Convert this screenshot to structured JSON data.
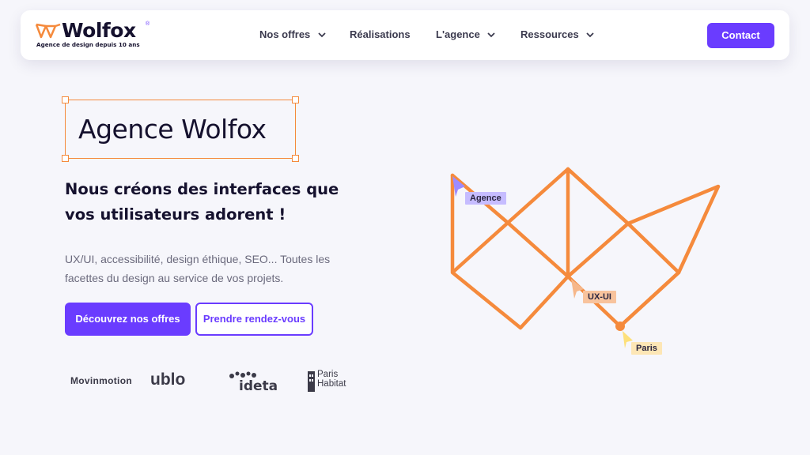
{
  "brand": {
    "name": "Wolfox",
    "registered": "®",
    "tagline": "Agence de design depuis 10 ans",
    "accent": "#6a3cff",
    "orange": "#f58a3c"
  },
  "nav": {
    "items": [
      {
        "label": "Nos offres",
        "dropdown": true
      },
      {
        "label": "Réalisations",
        "dropdown": false
      },
      {
        "label": "L'agence",
        "dropdown": true
      },
      {
        "label": "Ressources",
        "dropdown": true
      }
    ],
    "contact_label": "Contact"
  },
  "hero": {
    "title": "Agence Wolfox",
    "subtitle": "Nous créons des interfaces que vos utilisateurs adorent !",
    "description": "UX/UI, accessibilité, design éthique, SEO... Toutes les facettes du design au service de vos projets.",
    "primary_cta": "Découvrez nos offres",
    "secondary_cta": "Prendre rendez-vous"
  },
  "clients": {
    "movinmotion": "Movinmotion",
    "ublo": "ublo",
    "ideta": "ideta",
    "paris_habitat_line1": "Paris",
    "paris_habitat_line2": "Habitat"
  },
  "illustration": {
    "cursor_tags": [
      {
        "label": "Agence",
        "color": "#c6bcff"
      },
      {
        "label": "UX-UI",
        "color": "#f8c39d"
      },
      {
        "label": "Paris",
        "color": "#fde6b5"
      }
    ]
  }
}
